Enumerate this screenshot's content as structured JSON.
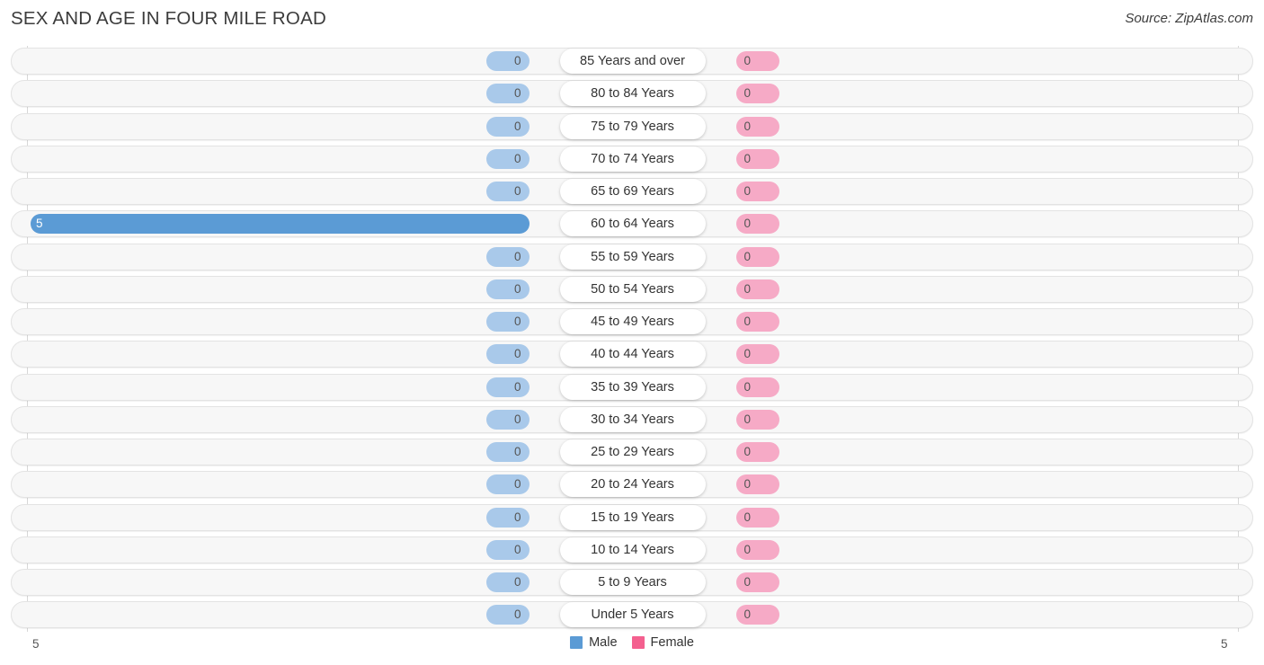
{
  "header": {
    "title": "SEX AND AGE IN FOUR MILE ROAD",
    "source": "Source: ZipAtlas.com"
  },
  "legend": {
    "items": [
      {
        "label": "Male",
        "color": "#5b9bd5",
        "icon": "square-swatch"
      },
      {
        "label": "Female",
        "color": "#f4608f",
        "icon": "square-swatch"
      }
    ]
  },
  "axis": {
    "left_label": "5",
    "right_label": "5",
    "max": 5,
    "min": 0
  },
  "colors": {
    "male_bar": "#a9c9ea",
    "male_bar_highlight": "#5b9bd5",
    "female_bar": "#f6aac6",
    "female_bar_highlight": "#f4608f",
    "track": "#f7f7f7",
    "track_border": "#e3e3e3",
    "gridline": "#d8d8d8",
    "title_text": "#3c3c3c"
  },
  "chart_data": {
    "type": "bar",
    "subtype": "diverging-population-pyramid",
    "title": "SEX AND AGE IN FOUR MILE ROAD",
    "xlabel": "",
    "ylabel": "",
    "xlim": [
      5,
      5
    ],
    "grid": true,
    "legend_position": "bottom-center",
    "categories": [
      "85 Years and over",
      "80 to 84 Years",
      "75 to 79 Years",
      "70 to 74 Years",
      "65 to 69 Years",
      "60 to 64 Years",
      "55 to 59 Years",
      "50 to 54 Years",
      "45 to 49 Years",
      "40 to 44 Years",
      "35 to 39 Years",
      "30 to 34 Years",
      "25 to 29 Years",
      "20 to 24 Years",
      "15 to 19 Years",
      "10 to 14 Years",
      "5 to 9 Years",
      "Under 5 Years"
    ],
    "series": [
      {
        "name": "Male",
        "color": "#5b9bd5",
        "values": [
          0,
          0,
          0,
          0,
          0,
          5,
          0,
          0,
          0,
          0,
          0,
          0,
          0,
          0,
          0,
          0,
          0,
          0
        ]
      },
      {
        "name": "Female",
        "color": "#f4608f",
        "values": [
          0,
          0,
          0,
          0,
          0,
          0,
          0,
          0,
          0,
          0,
          0,
          0,
          0,
          0,
          0,
          0,
          0,
          0
        ]
      }
    ]
  },
  "rows": [
    {
      "label": "85 Years and over",
      "male": "0",
      "female": "0",
      "male_pct": 0,
      "female_pct": 0,
      "highlight": false
    },
    {
      "label": "80 to 84 Years",
      "male": "0",
      "female": "0",
      "male_pct": 0,
      "female_pct": 0,
      "highlight": false
    },
    {
      "label": "75 to 79 Years",
      "male": "0",
      "female": "0",
      "male_pct": 0,
      "female_pct": 0,
      "highlight": false
    },
    {
      "label": "70 to 74 Years",
      "male": "0",
      "female": "0",
      "male_pct": 0,
      "female_pct": 0,
      "highlight": false
    },
    {
      "label": "65 to 69 Years",
      "male": "0",
      "female": "0",
      "male_pct": 0,
      "female_pct": 0,
      "highlight": false
    },
    {
      "label": "60 to 64 Years",
      "male": "5",
      "female": "0",
      "male_pct": 100,
      "female_pct": 0,
      "highlight": true
    },
    {
      "label": "55 to 59 Years",
      "male": "0",
      "female": "0",
      "male_pct": 0,
      "female_pct": 0,
      "highlight": false
    },
    {
      "label": "50 to 54 Years",
      "male": "0",
      "female": "0",
      "male_pct": 0,
      "female_pct": 0,
      "highlight": false
    },
    {
      "label": "45 to 49 Years",
      "male": "0",
      "female": "0",
      "male_pct": 0,
      "female_pct": 0,
      "highlight": false
    },
    {
      "label": "40 to 44 Years",
      "male": "0",
      "female": "0",
      "male_pct": 0,
      "female_pct": 0,
      "highlight": false
    },
    {
      "label": "35 to 39 Years",
      "male": "0",
      "female": "0",
      "male_pct": 0,
      "female_pct": 0,
      "highlight": false
    },
    {
      "label": "30 to 34 Years",
      "male": "0",
      "female": "0",
      "male_pct": 0,
      "female_pct": 0,
      "highlight": false
    },
    {
      "label": "25 to 29 Years",
      "male": "0",
      "female": "0",
      "male_pct": 0,
      "female_pct": 0,
      "highlight": false
    },
    {
      "label": "20 to 24 Years",
      "male": "0",
      "female": "0",
      "male_pct": 0,
      "female_pct": 0,
      "highlight": false
    },
    {
      "label": "15 to 19 Years",
      "male": "0",
      "female": "0",
      "male_pct": 0,
      "female_pct": 0,
      "highlight": false
    },
    {
      "label": "10 to 14 Years",
      "male": "0",
      "female": "0",
      "male_pct": 0,
      "female_pct": 0,
      "highlight": false
    },
    {
      "label": "5 to 9 Years",
      "male": "0",
      "female": "0",
      "male_pct": 0,
      "female_pct": 0,
      "highlight": false
    },
    {
      "label": "Under 5 Years",
      "male": "0",
      "female": "0",
      "male_pct": 0,
      "female_pct": 0,
      "highlight": false
    }
  ]
}
